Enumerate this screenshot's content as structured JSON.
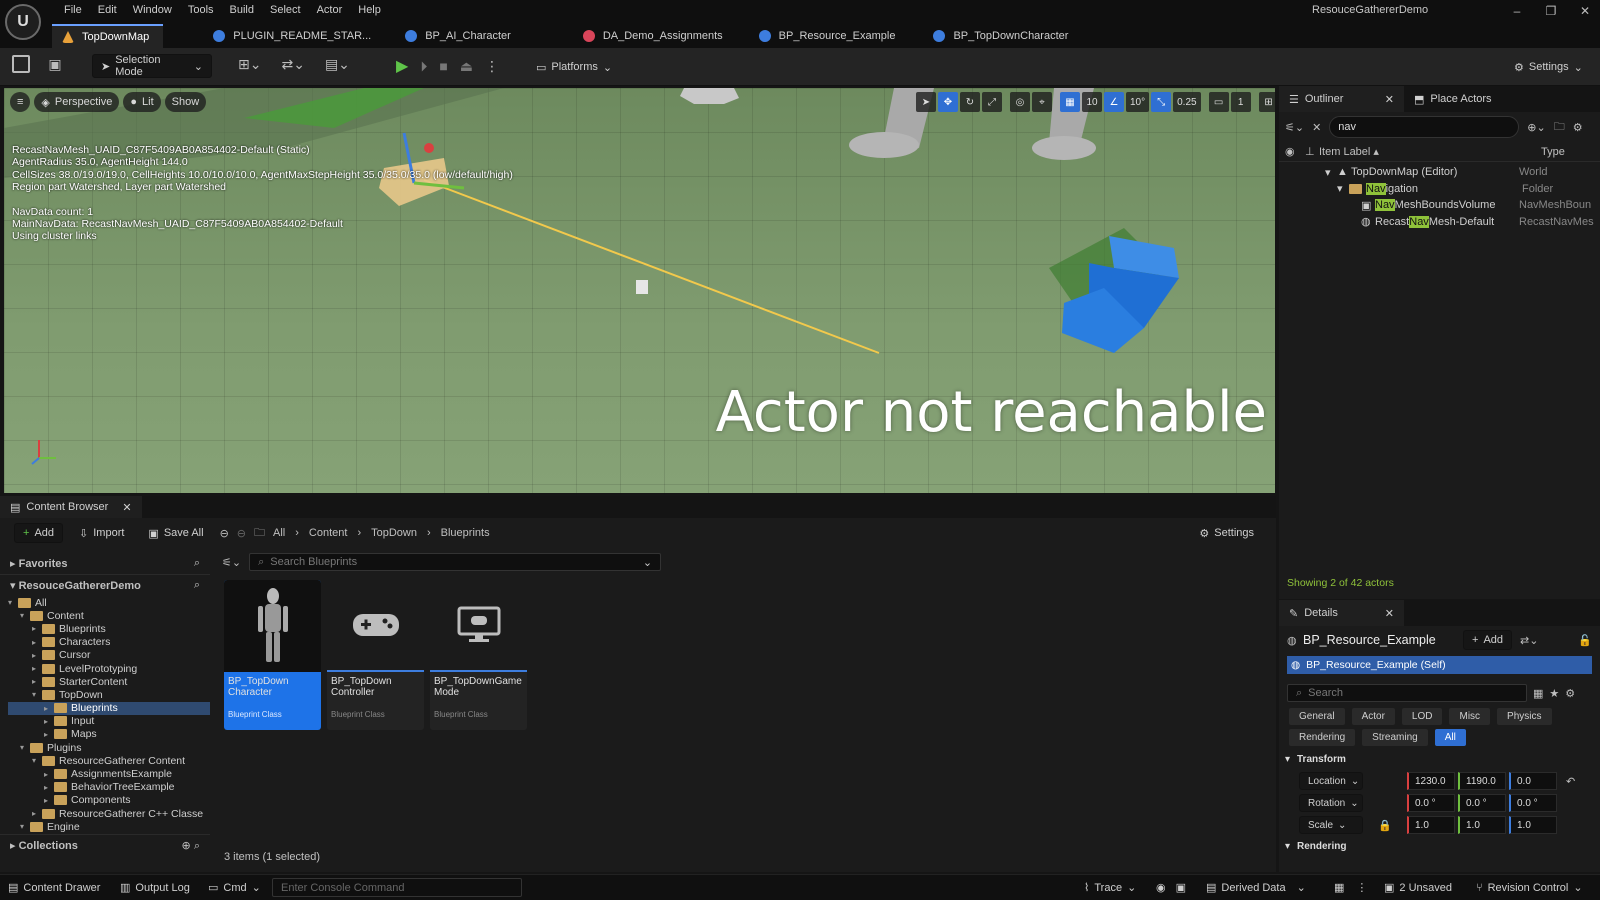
{
  "app": {
    "logo_text": "U",
    "menu": [
      "File",
      "Edit",
      "Window",
      "Tools",
      "Build",
      "Select",
      "Actor",
      "Help"
    ],
    "project_name": "ResouceGathererDemo",
    "window_controls": [
      "–",
      "❐",
      "✕"
    ]
  },
  "tabs": [
    {
      "label": "TopDownMap",
      "icon_color": "#e8a13a"
    },
    {
      "label": "PLUGIN_README_STAR...",
      "icon_color": "#3d7dde"
    },
    {
      "label": "BP_AI_Character",
      "icon_color": "#3d7dde"
    },
    {
      "label": "DA_Demo_Assignments",
      "icon_color": "#d9455a"
    },
    {
      "label": "BP_Resource_Example",
      "icon_color": "#3d7dde"
    },
    {
      "label": "BP_TopDownCharacter",
      "icon_color": "#3d7dde"
    }
  ],
  "toolbar": {
    "selection_mode": "Selection Mode",
    "platforms": "Platforms",
    "settings": "Settings"
  },
  "viewport": {
    "perspective": "Perspective",
    "lit": "Lit",
    "show": "Show",
    "grid_snap": "10",
    "rotation_snap": "10°",
    "scale_snap": "0.25",
    "camera_speed": "1",
    "debug_lines": [
      "RecastNavMesh_UAID_C87F5409AB0A854402-Default (Static)",
      "AgentRadius 35.0, AgentHeight 144.0",
      "CellSizes 38.0/19.0/19.0, CellHeights 10.0/10.0/10.0, AgentMaxStepHeight 35.0/35.0/35.0 (low/default/high)",
      "Region part Watershed, Layer part Watershed",
      "",
      "NavData count: 1",
      "MainNavData: RecastNavMesh_UAID_C87F5409AB0A854402-Default",
      "Using cluster links"
    ],
    "overlay_message": "Actor not reachable"
  },
  "outliner": {
    "tab_label": "Outliner",
    "place_actors": "Place Actors",
    "search_value": "nav",
    "columns": {
      "label": "Item Label ▴",
      "type": "Type"
    },
    "rows": [
      {
        "pre": "",
        "hl": "",
        "post": "TopDownMap (Editor)",
        "type": "World",
        "indent": 0
      },
      {
        "pre": "",
        "hl": "Nav",
        "post": "igation",
        "type": "Folder",
        "indent": 1
      },
      {
        "pre": "",
        "hl": "Nav",
        "post": "MeshBoundsVolume",
        "type": "NavMeshBoun",
        "indent": 2
      },
      {
        "pre": "Recast",
        "hl": "Nav",
        "post": "Mesh-Default",
        "type": "RecastNavMes",
        "indent": 2
      }
    ],
    "actor_count": "Showing 2 of 42 actors"
  },
  "details": {
    "tab_label": "Details",
    "object_name": "BP_Resource_Example",
    "add_label": "Add",
    "self_component": "BP_Resource_Example (Self)",
    "search_placeholder": "Search",
    "filters_row1": [
      "General",
      "Actor",
      "LOD",
      "Misc",
      "Physics"
    ],
    "filters_row2": [
      "Rendering",
      "Streaming",
      "All"
    ],
    "transform_header": "Transform",
    "location": {
      "label": "Location",
      "x": "1230.0",
      "y": "1190.0",
      "z": "0.0"
    },
    "rotation": {
      "label": "Rotation",
      "x": "0.0 °",
      "y": "0.0 °",
      "z": "0.0 °"
    },
    "scale": {
      "label": "Scale",
      "x": "1.0",
      "y": "1.0",
      "z": "1.0"
    },
    "rendering_header": "Rendering"
  },
  "content_browser": {
    "tab_label": "Content Browser",
    "add": "Add",
    "import": "Import",
    "save_all": "Save All",
    "breadcrumb": [
      "All",
      "Content",
      "TopDown",
      "Blueprints"
    ],
    "settings": "Settings",
    "favorites": "Favorites",
    "project_root": "ResouceGathererDemo",
    "search_placeholder": "Search Blueprints",
    "tree": [
      {
        "label": "All",
        "indent": 0
      },
      {
        "label": "Content",
        "indent": 1
      },
      {
        "label": "Blueprints",
        "indent": 2
      },
      {
        "label": "Characters",
        "indent": 2
      },
      {
        "label": "Cursor",
        "indent": 2
      },
      {
        "label": "LevelPrototyping",
        "indent": 2
      },
      {
        "label": "StarterContent",
        "indent": 2
      },
      {
        "label": "TopDown",
        "indent": 2
      },
      {
        "label": "Blueprints",
        "indent": 3,
        "selected": true
      },
      {
        "label": "Input",
        "indent": 3
      },
      {
        "label": "Maps",
        "indent": 3
      },
      {
        "label": "Plugins",
        "indent": 1
      },
      {
        "label": "ResourceGatherer Content",
        "indent": 2
      },
      {
        "label": "AssignmentsExample",
        "indent": 3
      },
      {
        "label": "BehaviorTreeExample",
        "indent": 3
      },
      {
        "label": "Components",
        "indent": 3
      },
      {
        "label": "ResourceGatherer C++ Classe",
        "indent": 2
      },
      {
        "label": "Engine",
        "indent": 1
      }
    ],
    "collections": "Collections",
    "assets": [
      {
        "name": "BP_TopDown Character",
        "type": "Blueprint Class",
        "selected": true,
        "icon": "character-thumbnail"
      },
      {
        "name": "BP_TopDown Controller",
        "type": "Blueprint Class",
        "selected": false,
        "icon": "gamepad-icon"
      },
      {
        "name": "BP_TopDownGame Mode",
        "type": "Blueprint Class",
        "selected": false,
        "icon": "monitor-icon"
      }
    ],
    "item_count": "3 items (1 selected)"
  },
  "statusbar": {
    "content_drawer": "Content Drawer",
    "output_log": "Output Log",
    "cmd": "Cmd",
    "console_placeholder": "Enter Console Command",
    "trace": "Trace",
    "derived_data": "Derived Data",
    "unsaved": "2 Unsaved",
    "revision_control": "Revision Control"
  },
  "colors": {
    "accent_blue": "#1e73e8",
    "highlight_green": "#8fc23a",
    "play_green": "#5fc449"
  }
}
